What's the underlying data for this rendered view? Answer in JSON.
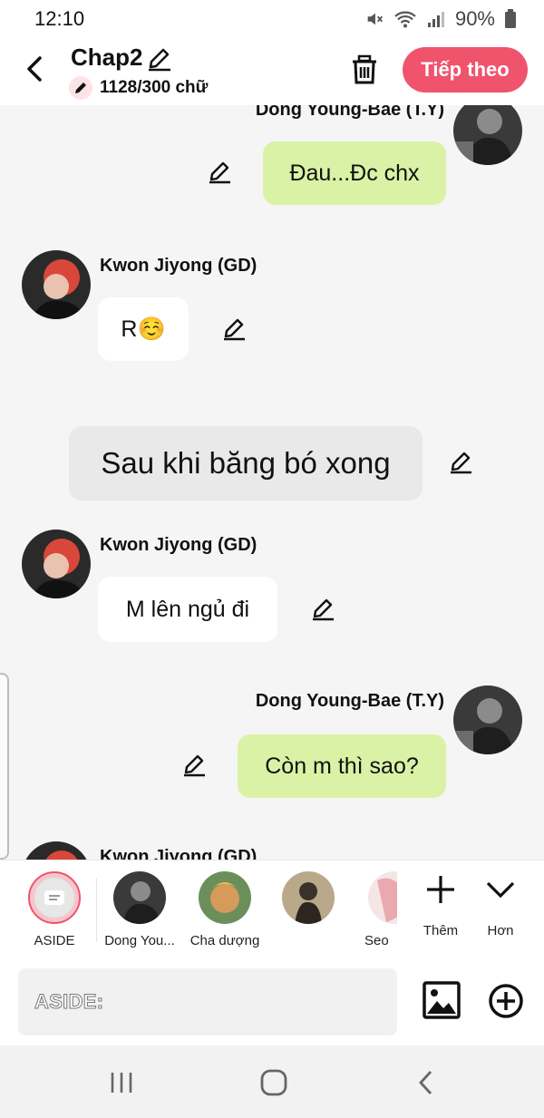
{
  "status": {
    "time": "12:10",
    "battery": "90%"
  },
  "header": {
    "title": "Chap2",
    "count": "1128/300 chữ",
    "next_label": "Tiếp theo"
  },
  "messages": [
    {
      "side": "right",
      "name": "Dong Young-Bae (T.Y)",
      "text": "Đau...Đc chx"
    },
    {
      "side": "left",
      "name": "Kwon Jiyong (GD)",
      "text": "R☺️"
    },
    {
      "side": "center",
      "text": "Sau khi băng bó xong"
    },
    {
      "side": "left",
      "name": "Kwon Jiyong (GD)",
      "text": "M lên ngủ đi"
    },
    {
      "side": "right",
      "name": "Dong Young-Bae (T.Y)",
      "text": "Còn m thì sao?"
    },
    {
      "side": "left",
      "name": "Kwon Jiyong (GD)",
      "text": ""
    }
  ],
  "characters": [
    {
      "label": "ASIDE"
    },
    {
      "label": "Dong You..."
    },
    {
      "label": "Cha dượng"
    },
    {
      "label": ""
    },
    {
      "label": "Seo"
    }
  ],
  "actions": {
    "add_label": "Thêm",
    "more_label": "Hơn"
  },
  "input": {
    "placeholder": "ASIDE:"
  }
}
